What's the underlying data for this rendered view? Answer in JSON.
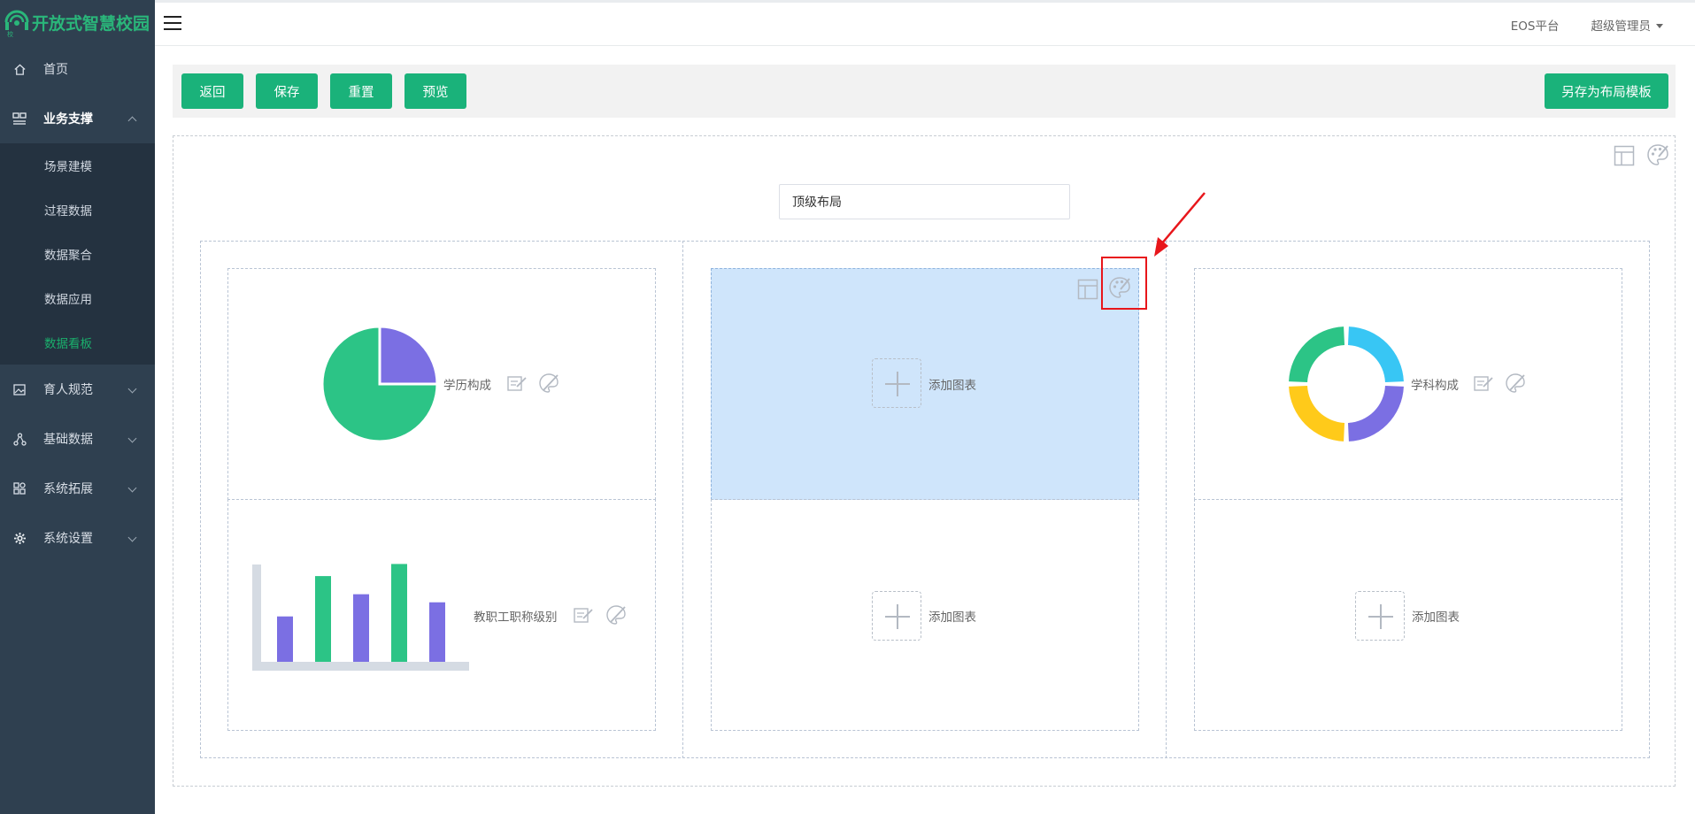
{
  "brand": {
    "name": "开放式智慧校园",
    "color": "#2ab67a"
  },
  "sidebar": {
    "items": [
      {
        "label": "首页",
        "icon": "home-icon"
      },
      {
        "label": "业务支撑",
        "icon": "layout-icon",
        "expanded": true,
        "children": [
          {
            "label": "场景建模"
          },
          {
            "label": "过程数据"
          },
          {
            "label": "数据聚合"
          },
          {
            "label": "数据应用"
          },
          {
            "label": "数据看板",
            "current": true
          }
        ]
      },
      {
        "label": "育人规范",
        "icon": "image-icon"
      },
      {
        "label": "基础数据",
        "icon": "nodes-icon"
      },
      {
        "label": "系统拓展",
        "icon": "extension-icon"
      },
      {
        "label": "系统设置",
        "icon": "settings-icon"
      }
    ]
  },
  "header": {
    "platform": "EOS平台",
    "user": "超级管理员"
  },
  "toolbar": {
    "back": "返回",
    "save": "保存",
    "reset": "重置",
    "preview": "预览",
    "save_as_template": "另存为布局模板"
  },
  "layout": {
    "title_value": "顶级布局",
    "cells": {
      "c1_label": "学历构成",
      "c2_label": "添加图表",
      "c3_label": "学科构成",
      "c4_label": "教职工职称级别",
      "c5_label": "添加图表",
      "c6_label": "添加图表"
    }
  },
  "colors": {
    "accent": "#1ab27a",
    "purple": "#7b6fe3",
    "green": "#2cc486",
    "cyan": "#38c6f4",
    "yellow": "#ffca1a",
    "highlight": "#cfe5fb",
    "annotation": "#e8161b"
  },
  "chart_data": [
    {
      "type": "pie",
      "title": "学历构成",
      "values": [
        75,
        25
      ],
      "colors": [
        "#2cc486",
        "#7b6fe3"
      ]
    },
    {
      "type": "pie",
      "title": "学科构成",
      "donut": true,
      "values": [
        25,
        25,
        25,
        25
      ],
      "colors": [
        "#38c6f4",
        "#7b6fe3",
        "#ffca1a",
        "#2cc486"
      ]
    },
    {
      "type": "bar",
      "title": "教职工职称级别",
      "values": [
        45,
        85,
        67,
        97,
        59
      ],
      "colors": [
        "#7b6fe3",
        "#2cc486",
        "#7b6fe3",
        "#2cc486",
        "#7b6fe3"
      ],
      "ylim": [
        0,
        100
      ]
    }
  ]
}
